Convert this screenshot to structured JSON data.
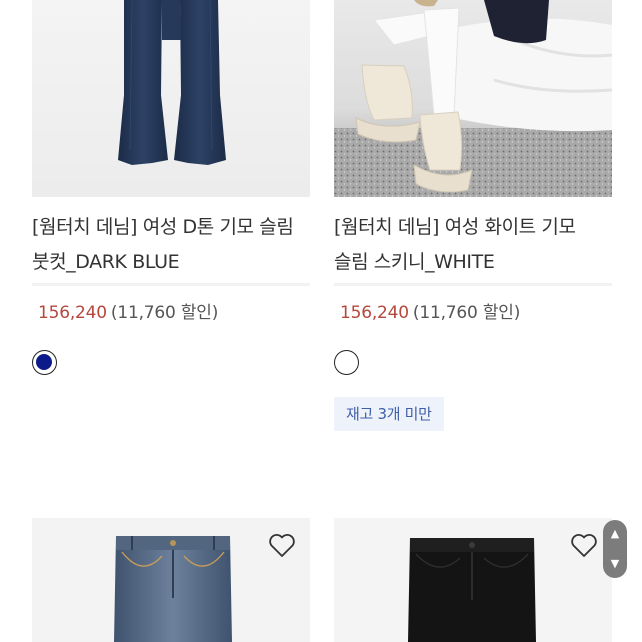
{
  "products": [
    {
      "title": "[웜터치 데님] 여성 D톤 기모 슬림 붓컷_DARK BLUE",
      "price": "156,240",
      "discount": "(11,760 할인)",
      "swatch_color": "#0d1a8a",
      "image": "dark-blue-bootcut-jeans"
    },
    {
      "title": "[웜터치 데님] 여성 화이트 기모 슬림 스키니_WHITE",
      "price": "156,240",
      "discount": "(11,760 할인)",
      "swatch_color": "#ffffff",
      "stock_badge": "재고 3개 미만",
      "image": "white-skinny-jeans-with-snow-boots"
    },
    {
      "image": "blue-washed-jeans",
      "wishlist_icon": "heart-outline-icon"
    },
    {
      "image": "black-jeans",
      "wishlist_icon": "heart-outline-icon"
    }
  ],
  "colors": {
    "price": "#b5473c",
    "stock_badge_bg": "#eef3fb",
    "stock_badge_text": "#3f5fa8",
    "scroll_button": "#7c7c7c"
  },
  "scroll_buttons": {
    "up_icon": "chevron-up-icon",
    "down_icon": "chevron-down-icon"
  }
}
